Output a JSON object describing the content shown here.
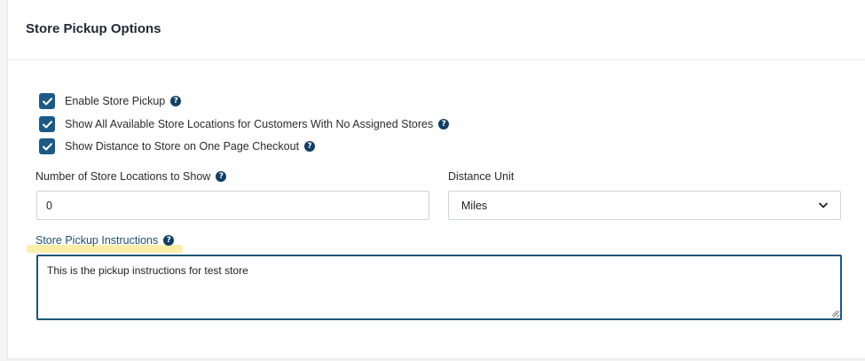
{
  "panel": {
    "title": "Store Pickup Options"
  },
  "checkboxes": [
    {
      "label": "Enable Store Pickup",
      "checked": true
    },
    {
      "label": "Show All Available Store Locations for Customers With No Assigned Stores",
      "checked": true
    },
    {
      "label": "Show Distance to Store on One Page Checkout",
      "checked": true
    }
  ],
  "store_locations": {
    "label": "Number of Store Locations to Show",
    "value": "0"
  },
  "distance_unit": {
    "label": "Distance Unit",
    "selected": "Miles"
  },
  "instructions": {
    "label": "Store Pickup Instructions",
    "value": "This is the pickup instructions for test store"
  },
  "colors": {
    "checkbox": "#1c5a84",
    "help_icon": "#123f63",
    "textarea_border": "#1f5577",
    "label_highlight": "#fbeea8"
  },
  "icons": {
    "help": "question-circle-icon",
    "check": "checkmark-icon",
    "dropdown": "chevron-down-icon"
  }
}
